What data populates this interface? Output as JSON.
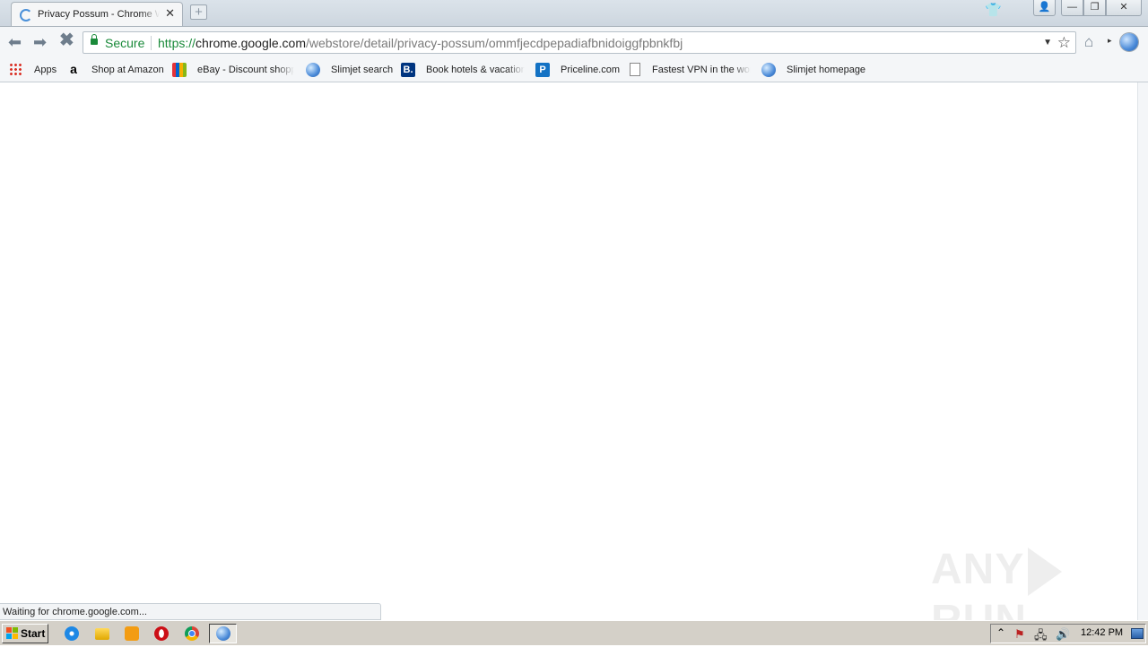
{
  "tab": {
    "title": "Privacy Possum - Chrome Web Store",
    "close_glyph": "✕"
  },
  "newtab_glyph": "+",
  "window_controls": {
    "user_glyph": "👤",
    "minimize_glyph": "—",
    "maximize_glyph": "❐",
    "close_glyph": "✕"
  },
  "toolbar": {
    "back_glyph": "⬅",
    "forward_glyph": "➡",
    "stop_glyph": "✖",
    "home_glyph": "⌂",
    "home_menu_glyph": "▸"
  },
  "omnibox": {
    "security_label": "Secure",
    "url_scheme": "https://",
    "url_host": "chrome.google.com",
    "url_path": "/webstore/detail/privacy-possum/ommfjecdpepadiafbnidoiggfpbnkfbj",
    "dropdown_glyph": "▼",
    "star_glyph": "☆"
  },
  "bookmarks": [
    {
      "label": "Apps",
      "icon": "apps-grid-icon"
    },
    {
      "label": "Shop at Amazon",
      "icon": "amazon-icon",
      "glyph": "a"
    },
    {
      "label": "eBay - Discount shopping",
      "icon": "ebay-icon"
    },
    {
      "label": "Slimjet search",
      "icon": "globe-icon"
    },
    {
      "label": "Book hotels & vacation rentals",
      "icon": "booking-icon",
      "glyph": "B."
    },
    {
      "label": "Priceline.com",
      "icon": "priceline-icon",
      "glyph": "P"
    },
    {
      "label": "Fastest VPN in the world",
      "icon": "page-icon"
    },
    {
      "label": "Slimjet homepage",
      "icon": "globe-icon"
    }
  ],
  "status_text": "Waiting for chrome.google.com...",
  "watermark": {
    "left": "ANY",
    "right": "RUN"
  },
  "taskbar": {
    "start_label": "Start",
    "tray_chevron": "⌃",
    "tray_flag_glyph": "⚑",
    "tray_network_glyph": "🖧",
    "tray_volume_glyph": "🔊",
    "clock": "12:42 PM"
  },
  "colors": {
    "secure_green": "#1a8a3a",
    "loading_spinner": "#4a90d9",
    "taskbar_gray": "#d4d0c8"
  }
}
